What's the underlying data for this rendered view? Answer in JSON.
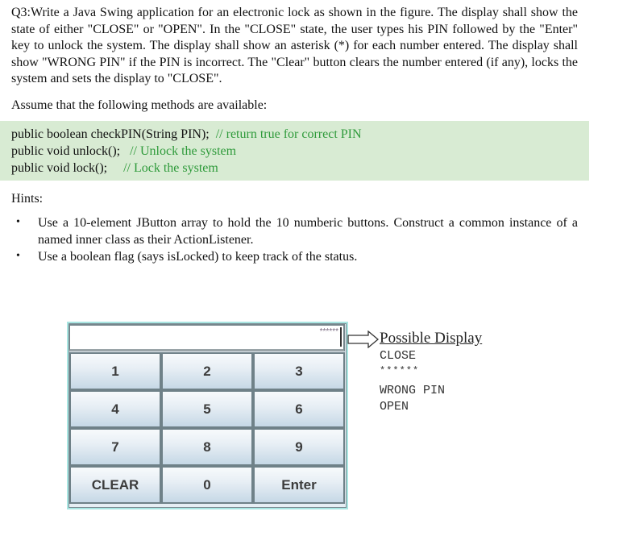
{
  "question": {
    "paragraph": "Q3:Write a Java Swing application for an electronic lock as shown in the figure. The display shall show the state of either \"CLOSE\" or \"OPEN\". In the \"CLOSE\" state, the user types his PIN followed by the \"Enter\" key to unlock the system. The display shall show an asterisk (*) for each number entered. The display shall show \"WRONG PIN\" if the PIN is incorrect. The \"Clear\" button clears the number entered (if any), locks the system and sets the display to \"CLOSE\".",
    "assume": "Assume that the following methods are available:"
  },
  "code": [
    {
      "code": "public boolean checkPIN(String PIN);  ",
      "comment": "// return true for correct PIN"
    },
    {
      "code": "public void unlock();   ",
      "comment": "// Unlock the system"
    },
    {
      "code": "public void lock();     ",
      "comment": "// Lock the system"
    }
  ],
  "hints": {
    "title": "Hints:",
    "bullet": "•",
    "items": [
      "Use a 10-element JButton array to hold the 10 numberic buttons. Construct a common instance of a named inner class as their ActionListener.",
      "Use a boolean flag (says isLocked) to keep track of the status."
    ]
  },
  "lock_ui": {
    "display_value": "******",
    "buttons": [
      "1",
      "2",
      "3",
      "4",
      "5",
      "6",
      "7",
      "8",
      "9",
      "CLEAR",
      "0",
      "Enter"
    ]
  },
  "possible_display": {
    "title": "Possible Display",
    "items": [
      "CLOSE",
      "******",
      "WRONG PIN",
      "OPEN"
    ]
  },
  "icons": {
    "arrow": "right-arrow-outline-icon"
  }
}
